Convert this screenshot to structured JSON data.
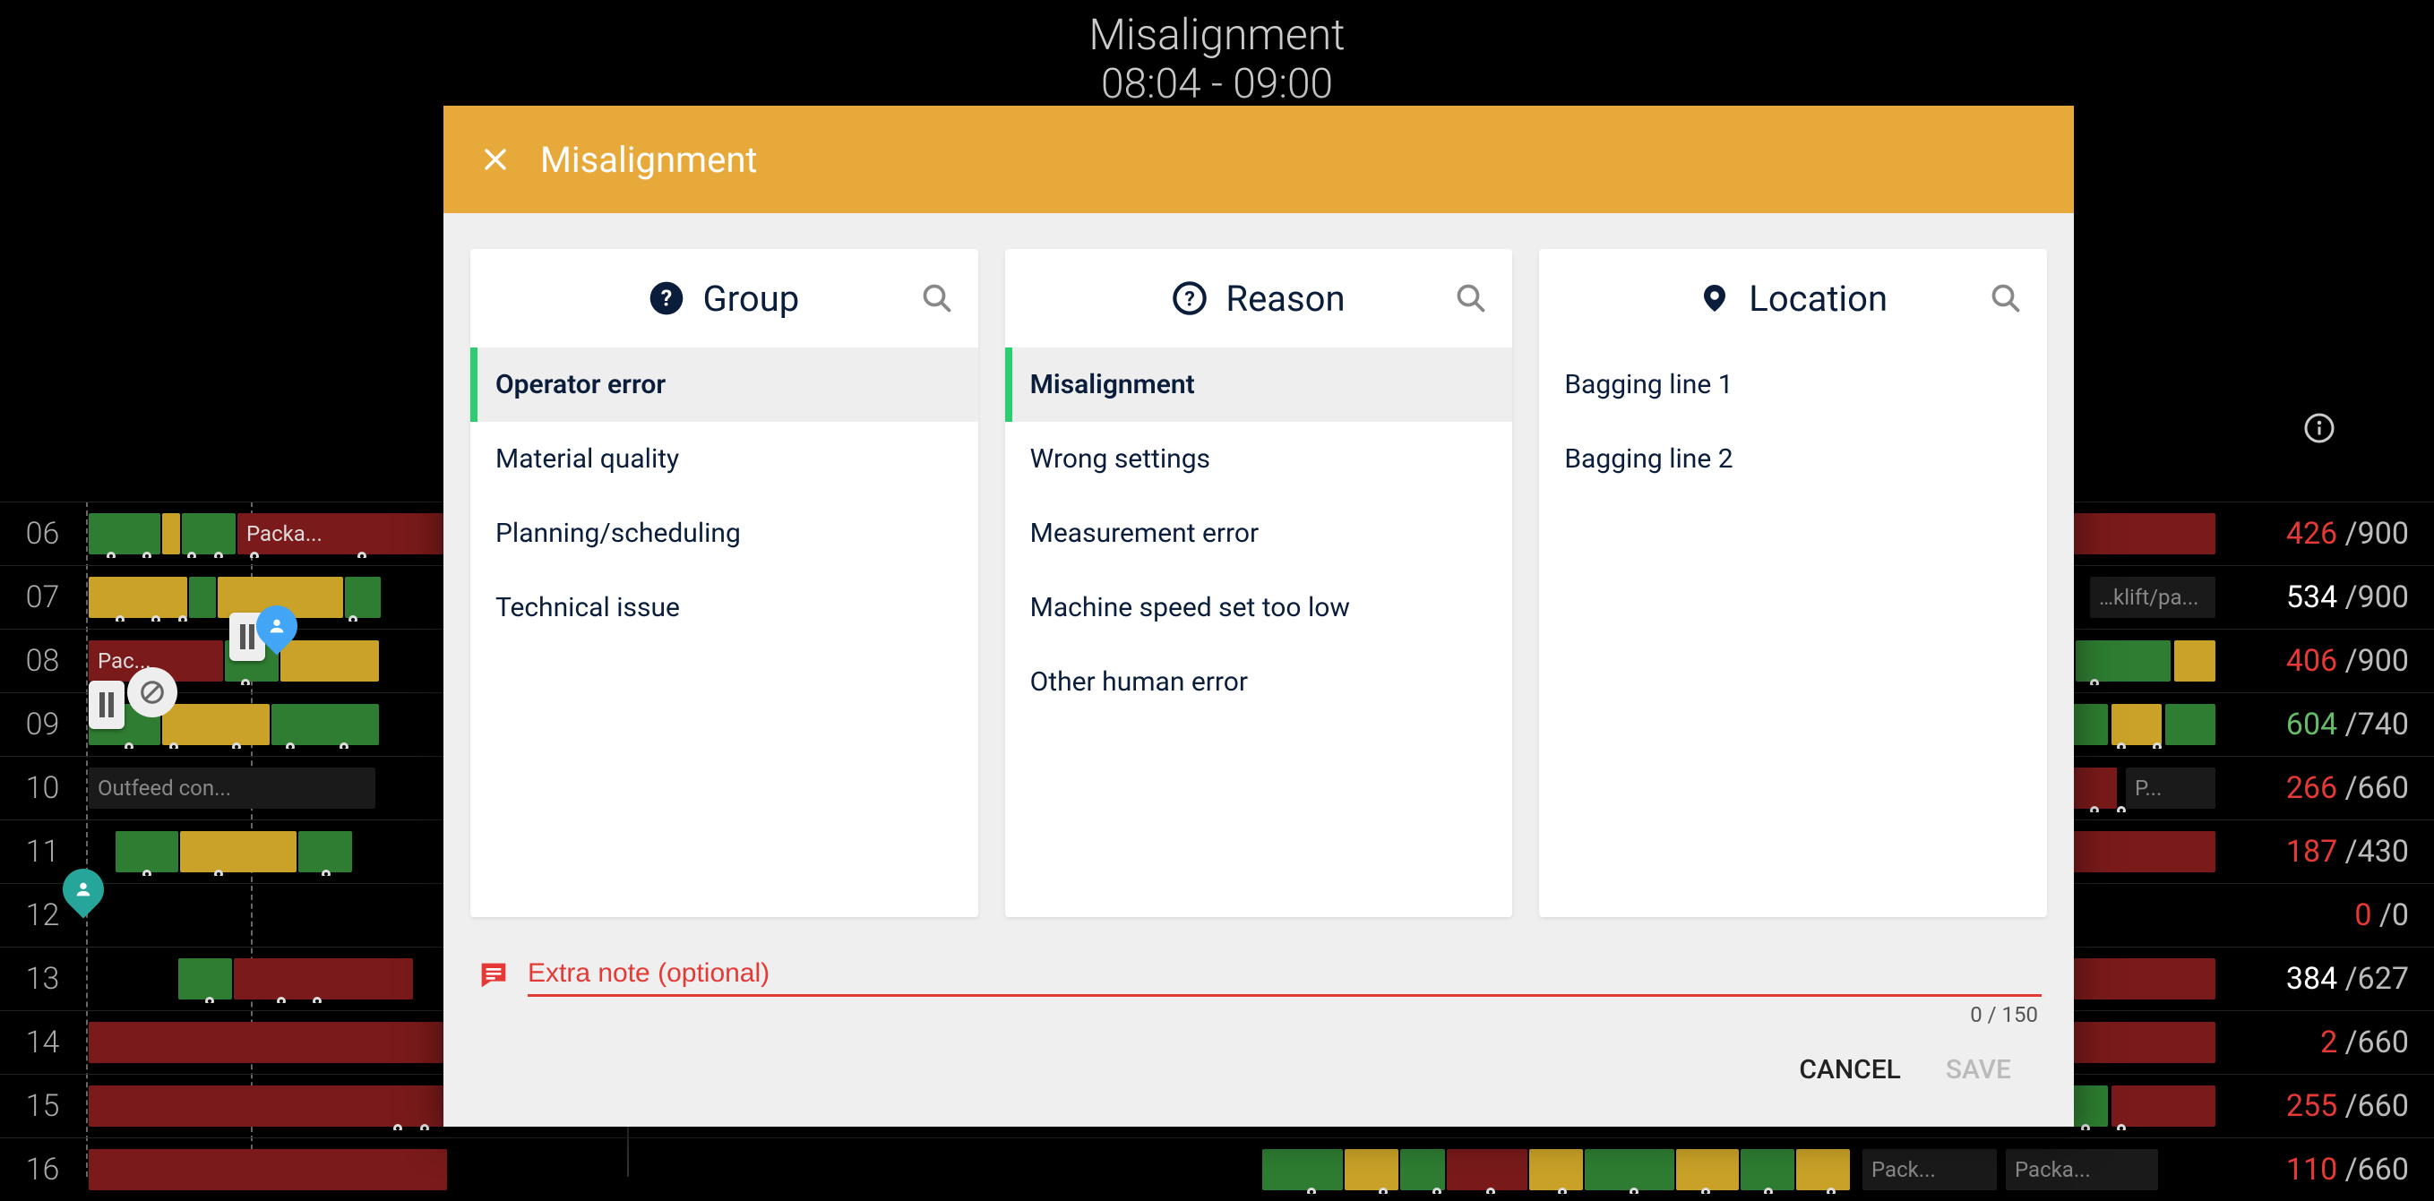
{
  "background": {
    "title": "Misalignment",
    "time_range": "08:04 - 09:00",
    "rows": [
      {
        "hour": "06",
        "value": 426,
        "target": 900,
        "color": "red",
        "label": "Packa..."
      },
      {
        "hour": "07",
        "value": 534,
        "target": 900,
        "color": "white",
        "label": ""
      },
      {
        "hour": "08",
        "value": 406,
        "target": 900,
        "color": "red",
        "label": "Pac..."
      },
      {
        "hour": "09",
        "value": 604,
        "target": 740,
        "color": "green",
        "label": ""
      },
      {
        "hour": "10",
        "value": 266,
        "target": 660,
        "color": "red",
        "label": "Outfeed con..."
      },
      {
        "hour": "11",
        "value": 187,
        "target": 430,
        "color": "red",
        "label": ""
      },
      {
        "hour": "12",
        "value": 0,
        "target": 0,
        "color": "red",
        "label": ""
      },
      {
        "hour": "13",
        "value": 384,
        "target": 627,
        "color": "white",
        "label": ""
      },
      {
        "hour": "14",
        "value": 2,
        "target": 660,
        "color": "red",
        "label": ""
      },
      {
        "hour": "15",
        "value": 255,
        "target": 660,
        "color": "red",
        "label": ""
      },
      {
        "hour": "16",
        "value": 110,
        "target": 660,
        "color": "red",
        "label": ""
      }
    ],
    "right_labels": {
      "r07": "…klift/pa...",
      "r10": "P...",
      "r16a": "Pack...",
      "r16b": "Packa..."
    }
  },
  "modal": {
    "title": "Misalignment",
    "columns": {
      "group": {
        "label": "Group",
        "items": [
          {
            "label": "Operator error",
            "selected": true
          },
          {
            "label": "Material quality",
            "selected": false
          },
          {
            "label": "Planning/scheduling",
            "selected": false
          },
          {
            "label": "Technical issue",
            "selected": false
          }
        ]
      },
      "reason": {
        "label": "Reason",
        "items": [
          {
            "label": "Misalignment",
            "selected": true
          },
          {
            "label": "Wrong settings",
            "selected": false
          },
          {
            "label": "Measurement error",
            "selected": false
          },
          {
            "label": "Machine speed set too low",
            "selected": false
          },
          {
            "label": "Other human error",
            "selected": false
          }
        ]
      },
      "location": {
        "label": "Location",
        "items": [
          {
            "label": "Bagging line 1",
            "selected": false
          },
          {
            "label": "Bagging line 2",
            "selected": false
          }
        ]
      }
    },
    "note": {
      "placeholder": "Extra note (optional)",
      "counter": "0 / 150"
    },
    "actions": {
      "cancel": "CANCEL",
      "save": "SAVE"
    }
  }
}
